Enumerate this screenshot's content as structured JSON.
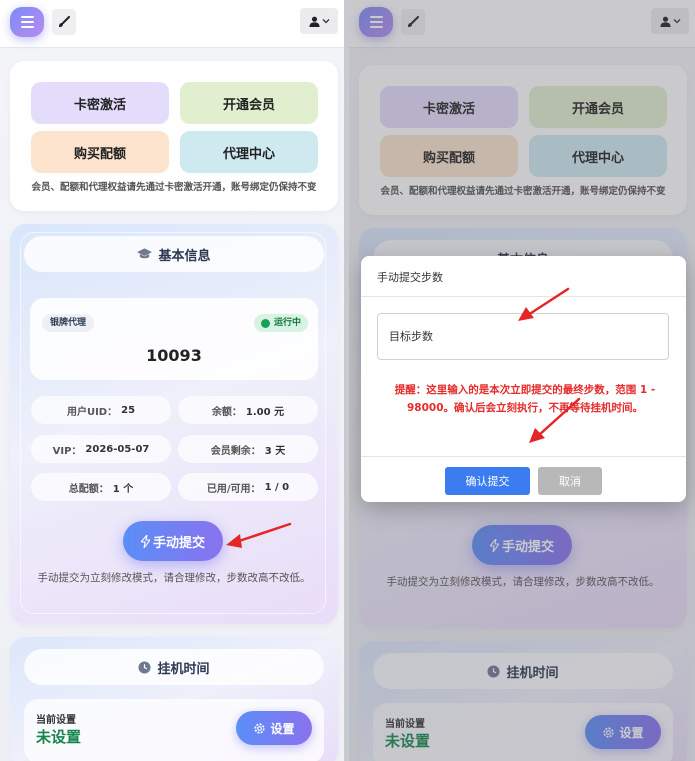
{
  "topbar": {
    "menu_icon": "hamburger-icon",
    "brush_icon": "brush-icon",
    "user_icon": "user-icon",
    "dropdown_icon": "chevron-down-icon"
  },
  "quick": {
    "activate": "卡密激活",
    "vip": "开通会员",
    "buy_quota": "购买配额",
    "agent_center": "代理中心",
    "note": "会员、配额和代理权益请先通过卡密激活开通，账号绑定仍保持不变"
  },
  "info": {
    "title": "基本信息",
    "agent_tag": "银牌代理",
    "status": "运行中",
    "number": "10093",
    "uid_label": "用户UID：",
    "uid_value": "25",
    "balance_label": "余额：",
    "balance_value": "1.00 元",
    "vip_label": "VIP：",
    "vip_value": "2026-05-07",
    "member_left_label": "会员剩余：",
    "member_left_value": "3 天",
    "total_quota_label": "总配额：",
    "total_quota_value": "1 个",
    "used_label": "已用/可用：",
    "used_value": "1 / 0",
    "submit_label": "手动提交",
    "submit_note": "手动提交为立刻修改模式，请合理修改，步数改高不改低。"
  },
  "hang": {
    "title": "挂机时间",
    "current_label": "当前设置",
    "current_value": "未设置",
    "set_label": "设置"
  },
  "modal": {
    "title": "手动提交步数",
    "placeholder": "目标步数",
    "warning": "提醒：这里输入的是本次立即提交的最终步数，范围 1 - 98000。确认后会立刻执行，不再等待挂机时间。",
    "confirm": "确认提交",
    "cancel": "取消"
  },
  "colors": {
    "accent": "#3b7cf0",
    "warning": "#e52b2b",
    "success": "#16864d",
    "arrow": "#e52626"
  }
}
